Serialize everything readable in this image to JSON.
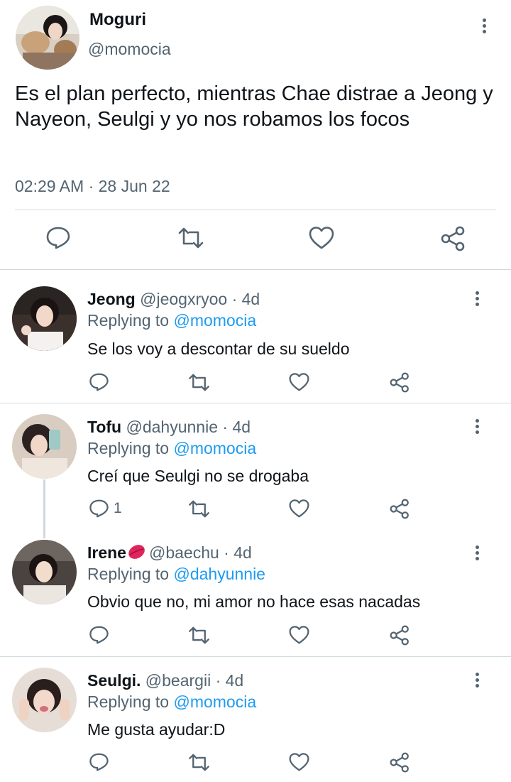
{
  "main_tweet": {
    "display_name": "Moguri",
    "handle": "@momocia",
    "text": "Es el plan perfecto, mientras Chae distrae a Jeong y Nayeon, Seulgi y yo nos robamos los focos",
    "timestamp": "02:29 AM · 28 Jun 22",
    "actions": [
      "reply-icon",
      "retweet-icon",
      "like-icon",
      "share-icon"
    ]
  },
  "replies": [
    {
      "display_name": "Jeong",
      "handle": "@jeogxryoo",
      "time": " · 4d",
      "replying_prefix": "Replying to ",
      "replying_to": "@momocia",
      "text": "Se los voy a descontar de su sueldo",
      "reply_count": ""
    },
    {
      "display_name": "Tofu",
      "handle": "@dahyunnie",
      "time": " · 4d",
      "replying_prefix": "Replying to ",
      "replying_to": "@momocia",
      "text": "Creí que Seulgi no se drogaba",
      "reply_count": "1"
    },
    {
      "display_name": "Irene",
      "name_emoji": "lips-kiss-icon",
      "handle": "@baechu",
      "time": " · 4d",
      "replying_prefix": "Replying to ",
      "replying_to": "@dahyunnie",
      "text": "Obvio que no, mi amor no hace esas nacadas",
      "reply_count": ""
    },
    {
      "display_name": "Seulgi.",
      "handle": "@beargii",
      "time": " · 4d",
      "replying_prefix": "Replying to ",
      "replying_to": "@momocia",
      "text": "Me gusta ayudar:D",
      "reply_count": ""
    }
  ],
  "colors": {
    "text": "#0f1419",
    "secondary": "#536471",
    "link": "#1d9bf0",
    "divider": "#cfd9de",
    "emoji": "#e0245e"
  }
}
